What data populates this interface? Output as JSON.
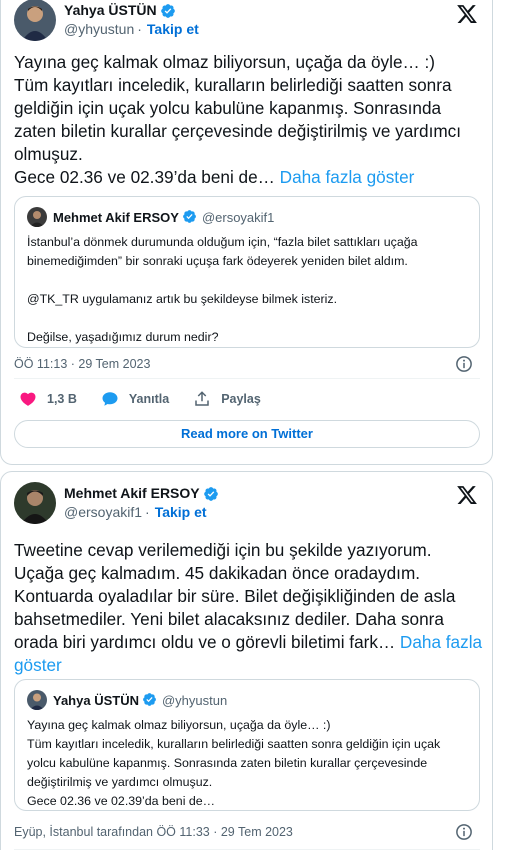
{
  "tweet1": {
    "author_name": "Yahya ÜSTÜN",
    "author_handle": "@yhyustun",
    "separator": "·",
    "follow_label": "Takip et",
    "text": "Yayına geç kalmak olmaz biliyorsun, uçağa da öyle… :)\nTüm kayıtları inceledik, kuralların belirlediği saatten sonra geldiğin için uçak yolcu kabulüne kapanmış. Sonrasında zaten biletin kurallar çerçevesinde değiştirilmiş ve yardımcı olmuşuz.\nGece 02.36 ve 02.39’da beni de…",
    "show_more": "Daha fazla göster",
    "quote": {
      "author_name": "Mehmet Akif ERSOY",
      "author_handle": "@ersoyakif1",
      "text": "İstanbul’a dönmek durumunda olduğum için, “fazla bilet sattıkları uçağa binemediğimden” bir sonraki uçuşa fark ödeyerek yeniden bilet aldım.\n\n@TK_TR uygulamanız artık bu şekildeyse bilmek isteriz.\n\nDeğilse, yaşadığımız durum nedir?"
    },
    "timestamp": "ÖÖ 11:13 · 29 Tem 2023",
    "likes": "1,3 B",
    "reply_label": "Yanıtla",
    "share_label": "Paylaş",
    "read_more_label": "Read more on Twitter"
  },
  "tweet2": {
    "author_name": "Mehmet Akif ERSOY",
    "author_handle": "@ersoyakif1",
    "separator": "·",
    "follow_label": "Takip et",
    "text": "Tweetine cevap verilemediği için bu şekilde yazıyorum. Uçağa geç kalmadım. 45 dakikadan önce oradaydım. Kontuarda oyaladılar bir süre. Bilet değişikliğinden de asla bahsetmediler. Yeni bilet alacaksınız dediler. Daha sonra orada biri yardımcı oldu ve o görevli biletimi fark…",
    "show_more": "Daha fazla göster",
    "quote": {
      "author_name": "Yahya ÜSTÜN",
      "author_handle": "@yhyustun",
      "text": "Yayına geç kalmak olmaz biliyorsun, uçağa da öyle… :)\nTüm kayıtları inceledik, kuralların belirlediği saatten sonra geldiğin için uçak yolcu kabulüne kapanmış. Sonrasında zaten biletin kurallar çerçevesinde değiştirilmiş ve yardımcı olmuşuz.\nGece 02.36 ve 02.39’da beni de…"
    },
    "timestamp": "Eyüp, İstanbul tarafından ÖÖ 11:33 · 29 Tem 2023"
  },
  "icons": {
    "verified": "verified-badge-icon",
    "brand": "x-logo-icon",
    "info": "info-icon",
    "like": "heart-icon",
    "reply": "speech-bubble-icon",
    "share": "share-upload-icon"
  },
  "colors": {
    "link": "#1d9bf0",
    "follow": "#006fd6",
    "like": "#f91880",
    "border": "#cfd9de",
    "muted": "#536471"
  }
}
